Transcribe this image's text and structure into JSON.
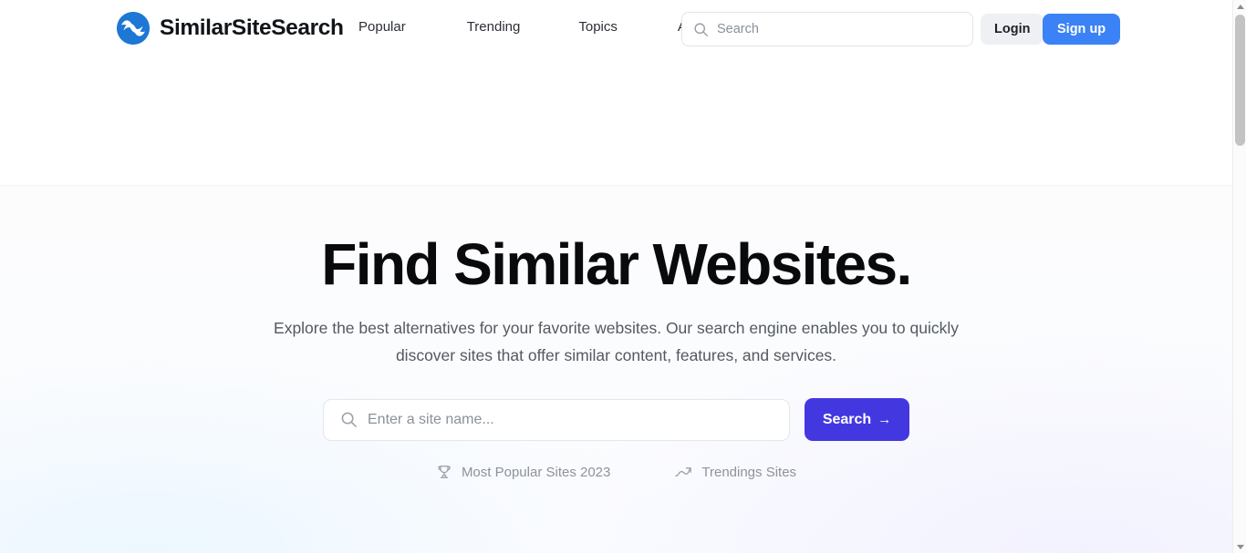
{
  "brand": {
    "name": "SimilarSiteSearch",
    "logo_icon": "wave-circle-logo-icon",
    "logo_color": "#1d77d4"
  },
  "header": {
    "nav_items": [
      {
        "label": "Popular",
        "name": "nav-item-popular"
      },
      {
        "label": "Trending",
        "name": "nav-item-trending"
      },
      {
        "label": "Topics",
        "name": "nav-item-topics"
      },
      {
        "label": "API",
        "name": "nav-item-api"
      }
    ],
    "search": {
      "placeholder": "Search",
      "value": "",
      "icon": "search-icon"
    },
    "login_label": "Login",
    "signup_label": "Sign up",
    "login_color": "#eef0f3",
    "signup_color": "#3b82f6"
  },
  "hero": {
    "title": "Find Similar Websites.",
    "subtitle": "Explore the best alternatives for your favorite websites. Our search engine enables you to quickly discover sites that offer similar content, features, and services.",
    "search": {
      "placeholder": "Enter a site name...",
      "value": "",
      "icon": "search-icon"
    },
    "search_button_label": "Search",
    "search_button_arrow": "→",
    "search_button_color": "#4338e0",
    "quick_links": [
      {
        "label": "Most Popular Sites 2023",
        "icon": "trophy-icon",
        "name": "quick-link-most-popular"
      },
      {
        "label": "Trendings Sites",
        "icon": "trending-up-icon",
        "name": "quick-link-trending"
      }
    ]
  },
  "scrollbar": {
    "up_icon": "scroll-up-arrow-icon",
    "down_icon": "scroll-down-arrow-icon"
  }
}
